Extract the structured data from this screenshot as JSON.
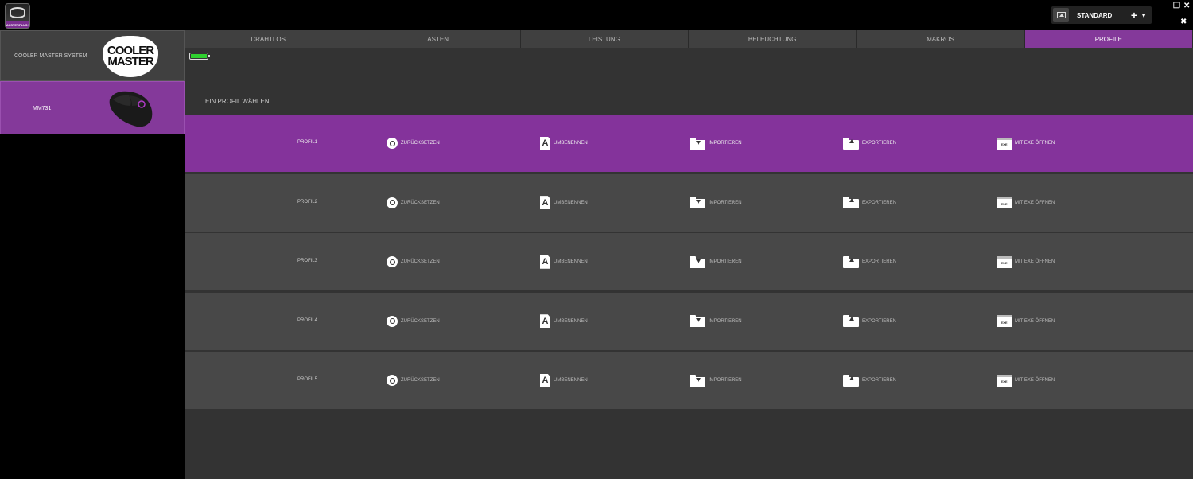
{
  "app": {
    "logo_text": "MASTERPLUS+"
  },
  "header": {
    "profile_select": {
      "label": "STANDARD"
    },
    "window_controls": {
      "minimize": "–",
      "restore": "❐",
      "close": "✕"
    }
  },
  "sidebar": {
    "devices": [
      {
        "label": "COOLER MASTER SYSTEM",
        "logo": [
          "COOLER",
          "MASTER"
        ],
        "selected": false
      },
      {
        "label": "MM731",
        "selected": true
      }
    ]
  },
  "tabs": [
    {
      "label": "DRAHTLOS",
      "active": false
    },
    {
      "label": "TASTEN",
      "active": false
    },
    {
      "label": "LEISTUNG",
      "active": false
    },
    {
      "label": "BELEUCHTUNG",
      "active": false
    },
    {
      "label": "MAKROS",
      "active": false
    },
    {
      "label": "PROFILE",
      "active": true
    }
  ],
  "battery": {
    "level": 1.0
  },
  "section_title": "EIN PROFIL WÄHLEN",
  "actions": {
    "reset": "ZURÜCKSETZEN",
    "rename": "UMBENENNEN",
    "import": "IMPORTIEREN",
    "export": "EXPORTIEREN",
    "open_exe": "MIT EXE ÖFFNEN",
    "rename_glyph": "A",
    "exe_glyph": "EXE"
  },
  "profiles": [
    {
      "name": "PROFIL1",
      "active": true
    },
    {
      "name": "PROFIL2",
      "active": false
    },
    {
      "name": "PROFIL3",
      "active": false
    },
    {
      "name": "PROFIL4",
      "active": false
    },
    {
      "name": "PROFIL5",
      "active": false
    }
  ],
  "colors": {
    "accent": "#84399a",
    "battery": "#2fd12f",
    "row": "#484848",
    "background": "#333333"
  }
}
